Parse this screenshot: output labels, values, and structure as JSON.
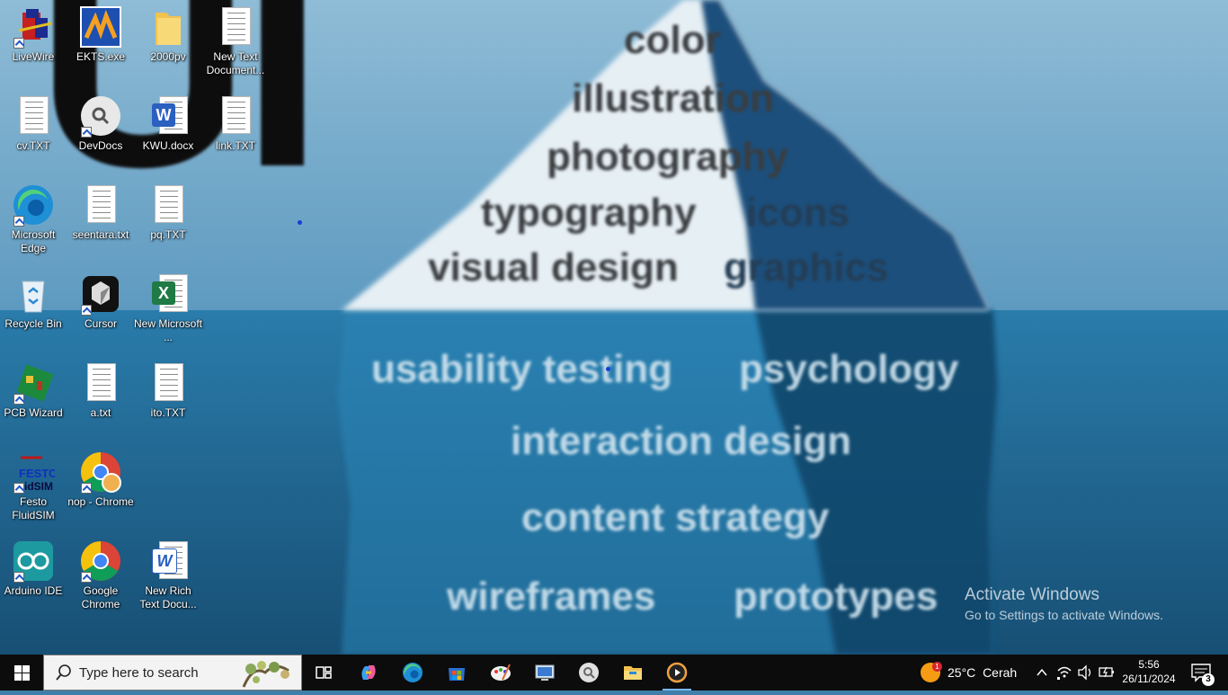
{
  "wallpaper": {
    "top_words": [
      "color",
      "illustration",
      "photography",
      "typography",
      "icons",
      "visual design",
      "graphics"
    ],
    "under_words": [
      "usability testing",
      "psychology",
      "interaction design",
      "content strategy",
      "wireframes",
      "prototypes"
    ],
    "big_text": "UI"
  },
  "desktop_icons": [
    {
      "label": "LiveWire"
    },
    {
      "label": "EKTS.exe"
    },
    {
      "label": "2000pv"
    },
    {
      "label": "New Text Document..."
    },
    {
      "label": "cv.TXT"
    },
    {
      "label": "DevDocs"
    },
    {
      "label": "KWU.docx"
    },
    {
      "label": "link.TXT"
    },
    {
      "label": "Microsoft Edge"
    },
    {
      "label": "seentara.txt"
    },
    {
      "label": "pq.TXT"
    },
    {
      "label": "Recycle Bin"
    },
    {
      "label": "Cursor"
    },
    {
      "label": "New Microsoft ..."
    },
    {
      "label": "PCB Wizard"
    },
    {
      "label": "a.txt"
    },
    {
      "label": "ito.TXT"
    },
    {
      "label": "Festo FluidSIM"
    },
    {
      "label": "nop - Chrome"
    },
    {
      "label": "Arduino IDE"
    },
    {
      "label": "Google Chrome"
    },
    {
      "label": "New Rich Text Docu..."
    }
  ],
  "activate_windows": {
    "title": "Activate Windows",
    "subtitle": "Go to Settings to activate Windows."
  },
  "taskbar": {
    "search_placeholder": "Type here to search",
    "apps": [
      "task-view",
      "copilot",
      "edge",
      "store",
      "paint",
      "remote-desktop",
      "devdocs",
      "file-explorer",
      "media-player"
    ],
    "weather": {
      "temp": "25°C",
      "condition": "Cerah",
      "badge": "1"
    },
    "time": "5:56",
    "date": "26/11/2024",
    "notifications_count": "3"
  },
  "colors": {
    "taskbar_bg": "#0c0c0c",
    "sky": "#6ea6c8",
    "sea": "#1c6f9c",
    "accent": "#76b9ed"
  }
}
